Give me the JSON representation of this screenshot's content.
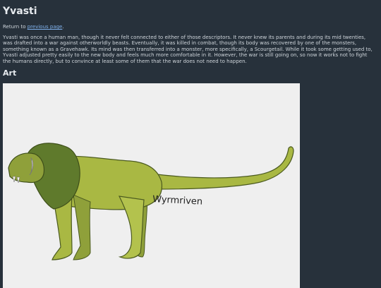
{
  "page": {
    "title": "Yvasti",
    "return_prefix": "Return to ",
    "return_link": "previous page",
    "return_suffix": ".",
    "bio": "Yvasti was once a human man, though it never felt connected to either of those descriptors. It never knew its parents and during its mid twenties, was drafted into a war against otherworldly beasts. Eventually, it was killed in combat, though its body was recovered by one of the monsters, something known as a Gravehawk. Its mind was then transferred into a monster, more specifically, a Scourgetail. While it took some getting used to, Yvasti adjusted pretty easily to the new body and feels much more comfortable in it. However, the war is still going on, so now it works not to fight the humans directly, but to convince at least some of them that the war does not need to happen.",
    "art_heading": "Art",
    "artwork_signature": "Wyrmriven"
  },
  "colors": {
    "background": "#27313b",
    "text": "#cfd5db",
    "link": "#7fb0ea",
    "art_background": "#efefef",
    "creature_body": "#a9b843",
    "creature_mane": "#5f7a2c"
  }
}
